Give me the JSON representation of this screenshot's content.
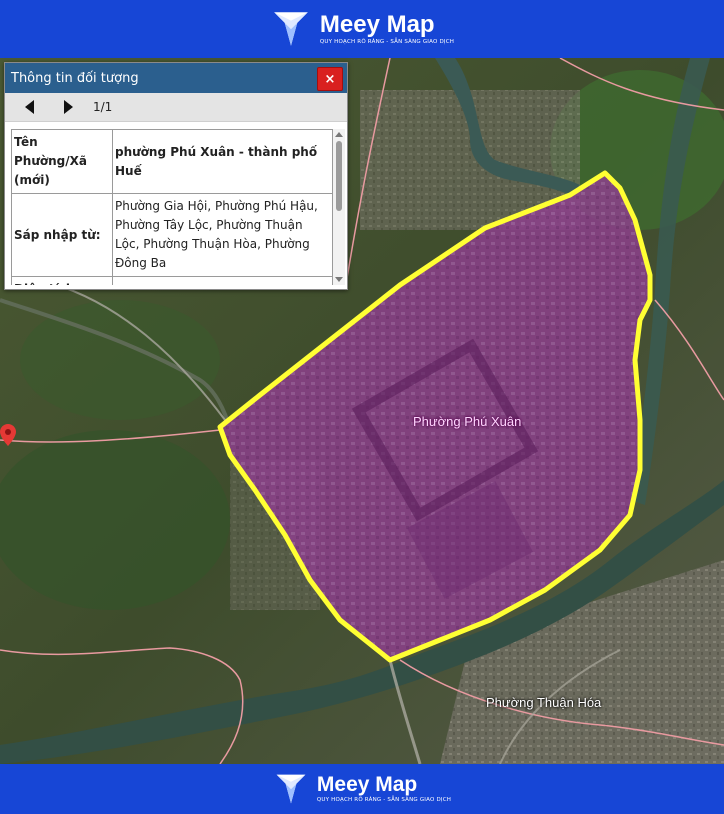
{
  "brand": {
    "name": "Meey Map",
    "tagline": "QUY HOẠCH RÕ RÀNG - SẴN SÀNG GIAO DỊCH",
    "accent_color": "#1746d6"
  },
  "panel": {
    "title": "Thông tin đối tượng",
    "close_label": "×",
    "prev_icon": "triangle-left-icon",
    "next_icon": "triangle-right-icon",
    "pager": "1/1",
    "rows": [
      {
        "key": "Tên Phường/Xã (mới)",
        "value": "phường Phú Xuân - thành phố Huế"
      },
      {
        "key": "Sáp nhập từ:",
        "value": "Phường Gia Hội, Phường Phú Hậu, Phường Tây Lộc, Phường Thuận Lộc, Phường Thuận Hòa, Phường Đông Ba"
      },
      {
        "key": "Diện tích",
        "value": ""
      }
    ]
  },
  "map": {
    "selected_ward_label": "Phường Phú Xuân",
    "neighbor_ward_label": "Phường Thuận Hóa",
    "highlight_fill": "#a02aa0",
    "highlight_border": "#ffff33",
    "pin_color": "#e53935"
  }
}
